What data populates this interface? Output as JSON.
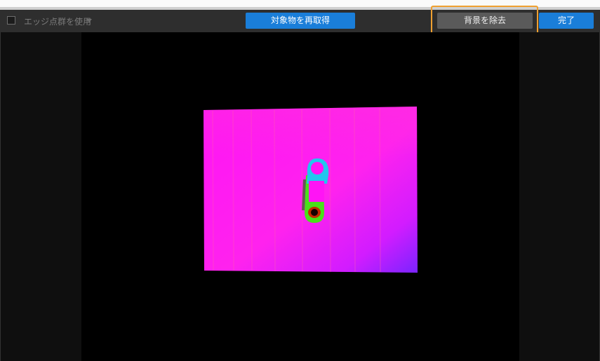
{
  "toolbar": {
    "edge_checkbox_label": "エッジ点群を使用",
    "edge_checkbox_checked": false,
    "reacquire_button_label": "対象物を再取得",
    "remove_background_button_label": "背景を除去",
    "done_button_label": "完了"
  },
  "colors": {
    "toolbar_bg": "#2e2e2e",
    "primary_button": "#1a7ed9",
    "secondary_button": "#5a5a5a",
    "highlight": "#f0a030",
    "viewport_bg": "#000000",
    "pointcloud_magenta": "#ff1aff",
    "pointcloud_violet": "#8a22ff",
    "object_cyan": "#22c6ee",
    "object_green": "#49e01a"
  },
  "icons": {
    "dropdown": "chevron-down-icon"
  }
}
